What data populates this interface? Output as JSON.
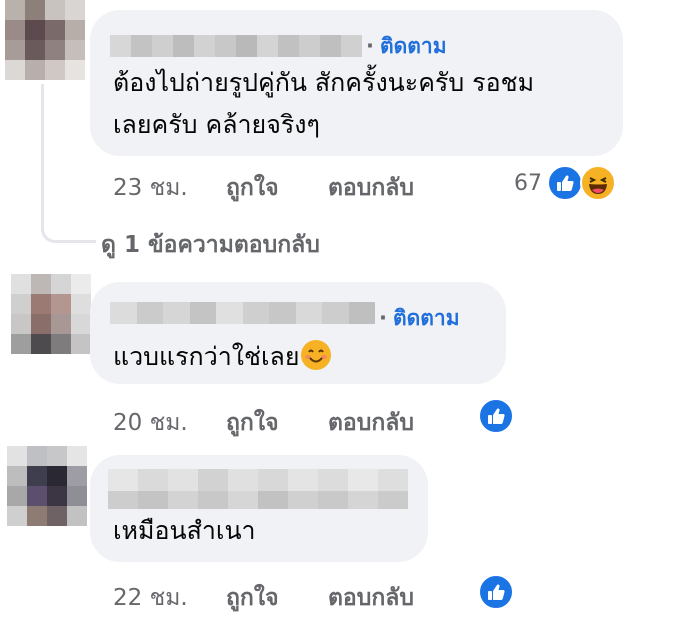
{
  "comments": [
    {
      "follow_label": "ติดตาม",
      "text_lines": [
        "ต้องไปถ่ายรูปคู่กัน สักครั้งนะครับ รอชม",
        "เลยครับ คล้ายจริงๆ"
      ],
      "time": "23 ชม.",
      "like_label": "ถูกใจ",
      "reply_label": "ตอบกลับ",
      "reaction_count": "67",
      "reactions": [
        "like-icon",
        "haha-icon"
      ]
    },
    {
      "follow_label": "ติดตาม",
      "text_lines": [
        "แวบแรกว่าใช่เลย"
      ],
      "inline_emoji": "smiling-face-icon",
      "time": "20 ชม.",
      "like_label": "ถูกใจ",
      "reply_label": "ตอบกลับ",
      "reactions": [
        "like-icon"
      ]
    },
    {
      "text_lines": [
        "เหมือนสำเนา"
      ],
      "time": "22 ชม.",
      "like_label": "ถูกใจ",
      "reply_label": "ตอบกลับ",
      "reactions": [
        "like-icon"
      ]
    }
  ],
  "view_replies": "ดู 1 ข้อความตอบกลับ",
  "colors": {
    "bubble": "#f0f2f5",
    "follow": "#216fdb",
    "meta": "#65676b",
    "like": "#1b74e4",
    "haha": "#f7b125"
  }
}
